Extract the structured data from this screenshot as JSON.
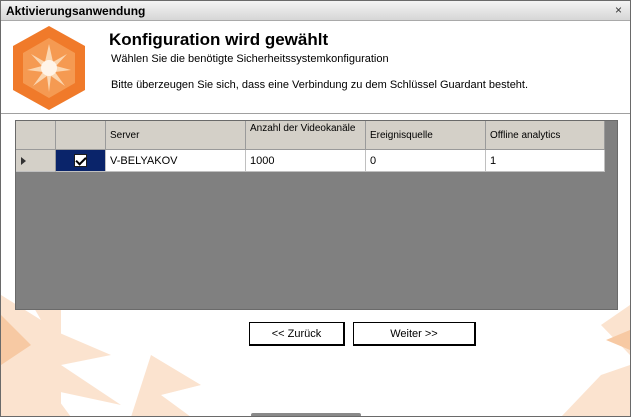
{
  "window": {
    "title": "Aktivierungsanwendung",
    "close_glyph": "×"
  },
  "header": {
    "title": "Konfiguration wird gewählt",
    "subtitle": "Wählen Sie die benötigte Sicherheitssystemkonfiguration",
    "note": "Bitte überzeugen Sie sich, dass eine Verbindung zu dem Schlüssel Guardant besteht."
  },
  "grid": {
    "columns": [
      "",
      "",
      "Server",
      "Anzahl der Videokanäle",
      "Ereignisquelle",
      "Offline analytics"
    ],
    "rows": [
      {
        "selected": true,
        "checked": true,
        "server": "V-BELYAKOV",
        "channels": "1000",
        "event_source": "0",
        "offline_analytics": "1"
      }
    ]
  },
  "buttons": {
    "back": "<< Zurück",
    "next": "Weiter >>"
  },
  "colors": {
    "accent_orange": "#f07a2a",
    "selection_blue": "#0a246a",
    "grid_bg": "#808080",
    "header_bg": "#d4d0c8"
  },
  "icons": {
    "logo": "orange-hexagon-star-logo",
    "close": "close-icon",
    "row_indicator": "row-arrow-icon"
  }
}
